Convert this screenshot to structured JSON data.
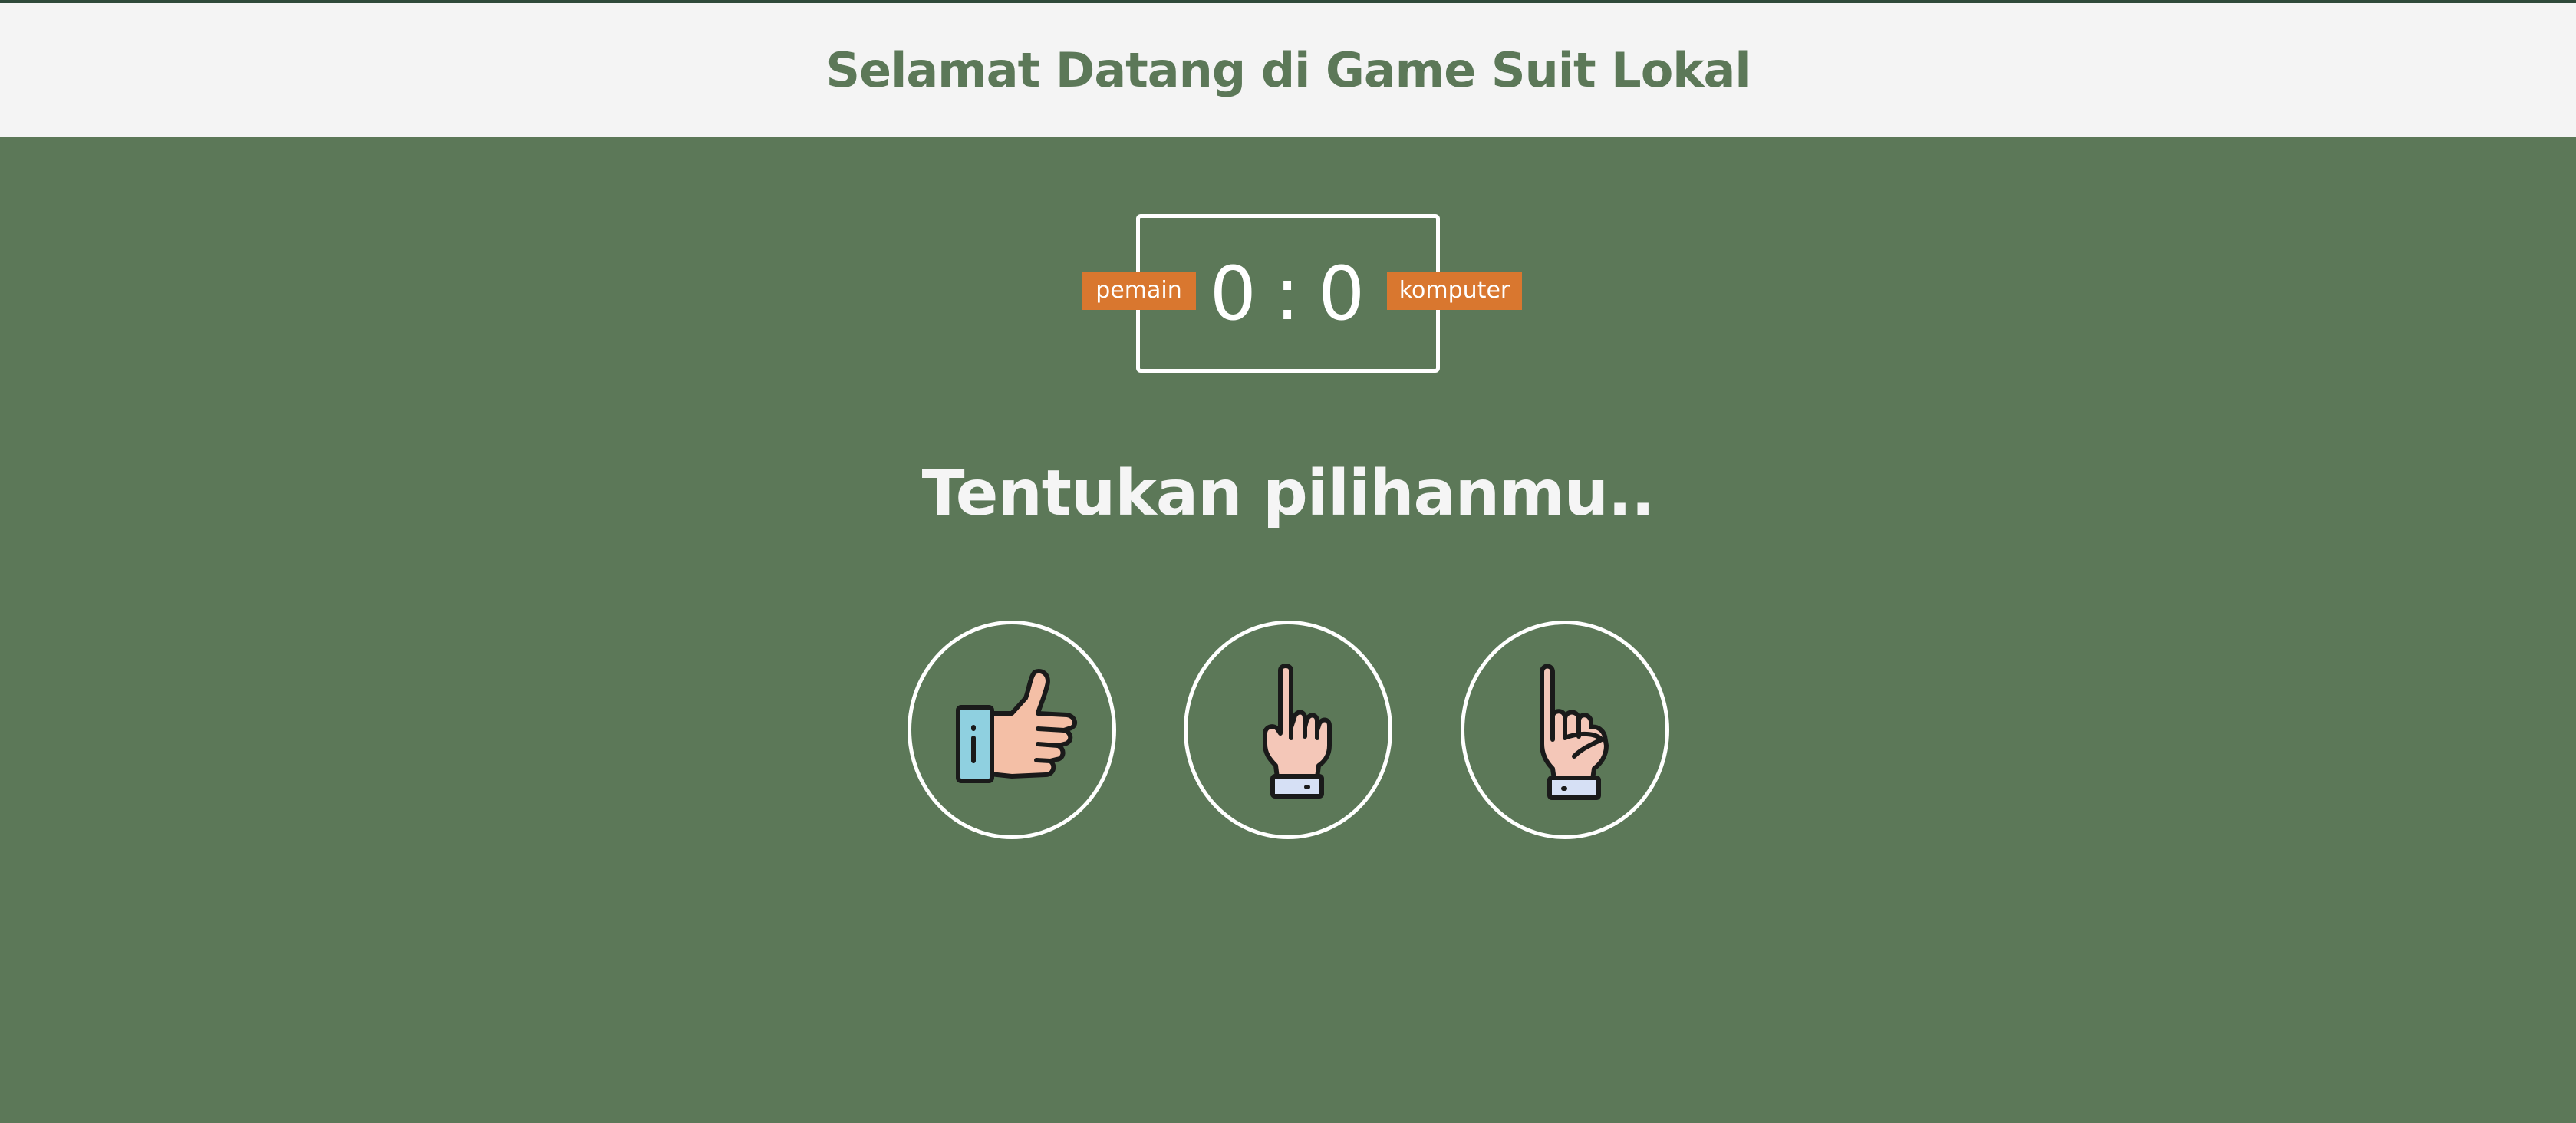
{
  "header": {
    "title": "Selamat Datang di Game Suit Lokal"
  },
  "scoreboard": {
    "player_label": "pemain",
    "computer_label": "komputer",
    "player_score": "0",
    "separator": ":",
    "computer_score": "0"
  },
  "prompt": "Tentukan pilihanmu..",
  "choices": [
    {
      "icon": "thumb-icon"
    },
    {
      "icon": "index-finger-icon"
    },
    {
      "icon": "pinky-finger-icon"
    }
  ],
  "colors": {
    "background": "#5c7858",
    "header_background": "#f4f4f4",
    "accent_label": "#d9772f",
    "title_text": "#5c7858",
    "light_text": "#ffffff"
  }
}
